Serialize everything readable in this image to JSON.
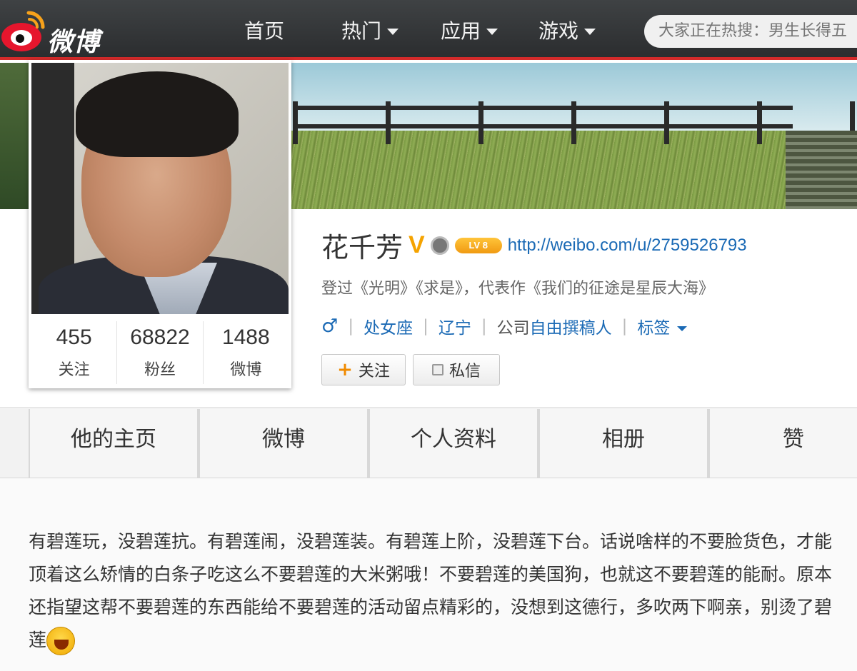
{
  "nav": {
    "logo_text": "微博",
    "items": [
      {
        "label": "首页",
        "has_menu": false
      },
      {
        "label": "热门",
        "has_menu": true
      },
      {
        "label": "应用",
        "has_menu": true
      },
      {
        "label": "游戏",
        "has_menu": true
      }
    ],
    "search_placeholder": "大家正在热搜：男生长得五"
  },
  "profile": {
    "name": "花千芳",
    "verified_mark": "V",
    "level": "LV 8",
    "url": "http://weibo.com/u/2759526793",
    "bio": "登过《光明》《求是》，代表作《我们的征途是星辰大海》",
    "gender_symbol": "♂",
    "zodiac": "处女座",
    "location": "辽宁",
    "company_prefix": "公司",
    "company": "自由撰稿人",
    "tags_label": "标签",
    "stats": [
      {
        "value": "455",
        "label": "关注"
      },
      {
        "value": "68822",
        "label": "粉丝"
      },
      {
        "value": "1488",
        "label": "微博"
      }
    ],
    "follow_label": "关注",
    "message_label": "私信"
  },
  "tabs": [
    "他的主页",
    "微博",
    "个人资料",
    "相册",
    "赞"
  ],
  "post": {
    "text": "有碧莲玩，没碧莲抗。有碧莲闹，没碧莲装。有碧莲上阶，没碧莲下台。话说啥样的不要脸货色，才能顶着这么矫情的白条子吃这么不要碧莲的大米粥哦！不要碧莲的美国狗，也就这不要碧莲的能耐。原本还指望这帮不要碧莲的东西能给不要碧莲的活动留点精彩的，没想到这德行，多吹两下啊亲，别烫了碧莲",
    "emoji": "laughing-emoji"
  },
  "colors": {
    "accent_red": "#d42a2a",
    "link_blue": "#1b6ab5",
    "verified_orange": "#f5a300"
  }
}
